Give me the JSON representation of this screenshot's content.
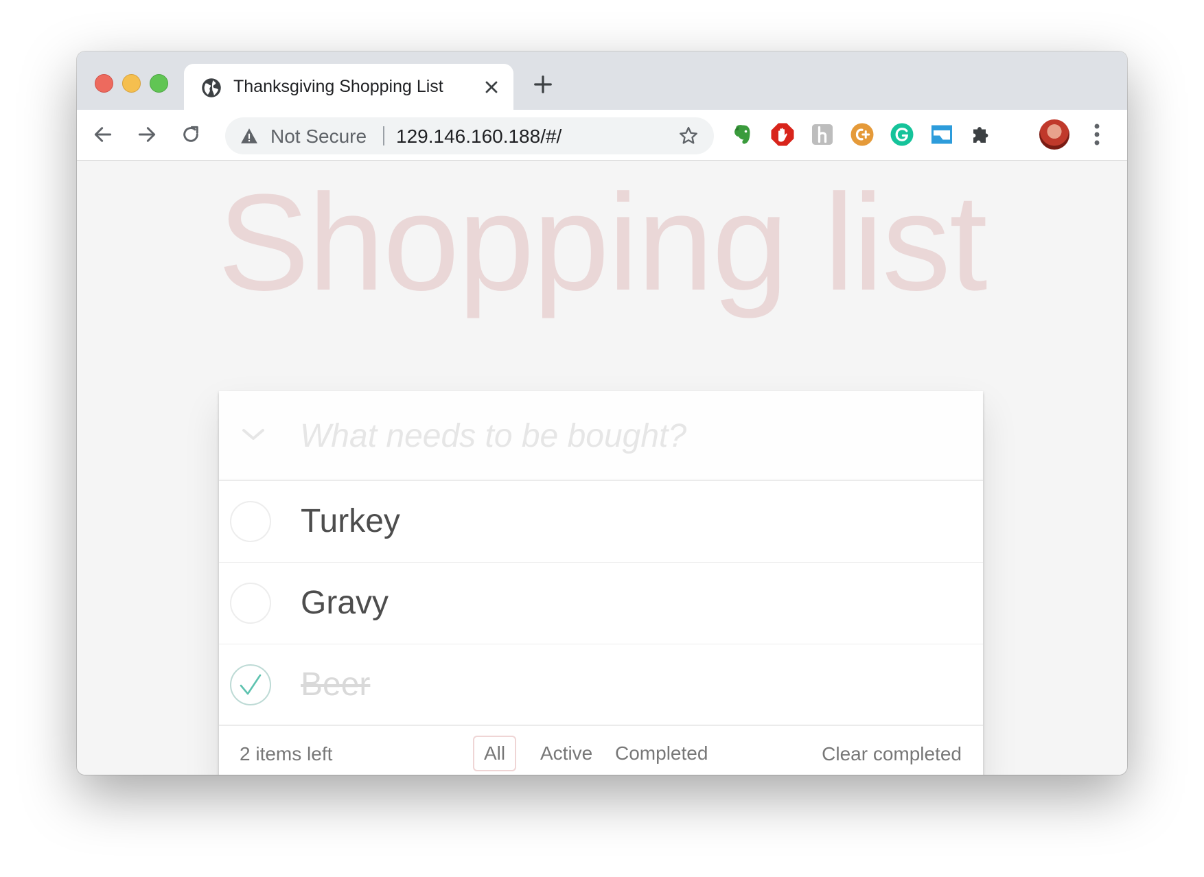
{
  "browser": {
    "tab": {
      "title": "Thanksgiving Shopping List",
      "favicon": "globe-icon"
    },
    "omnibox": {
      "security_label": "Not Secure",
      "url": "129.146.160.188/#/"
    },
    "extensions": [
      "evernote-icon",
      "adblock-icon",
      "honey-icon",
      "coupon-icon",
      "grammarly-icon",
      "window-icon",
      "puzzle-icon"
    ]
  },
  "app": {
    "title": "Shopping list",
    "new_item_placeholder": "What needs to be bought?",
    "items": [
      {
        "label": "Turkey",
        "completed": false
      },
      {
        "label": "Gravy",
        "completed": false
      },
      {
        "label": "Beer",
        "completed": true
      }
    ],
    "footer": {
      "count_text": "2 items left",
      "filters": [
        {
          "label": "All",
          "selected": true
        },
        {
          "label": "Active",
          "selected": false
        },
        {
          "label": "Completed",
          "selected": false
        }
      ],
      "clear_label": "Clear completed"
    }
  },
  "colors": {
    "title": "#af2f2f",
    "check": "#5dc2af",
    "text": "#4d4d4d",
    "muted": "#777777"
  }
}
